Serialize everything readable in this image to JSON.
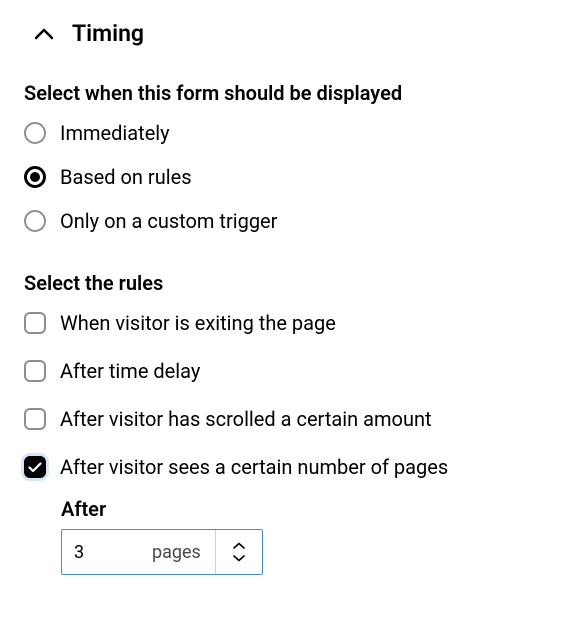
{
  "section": {
    "title": "Timing"
  },
  "display": {
    "title": "Select when this form should be displayed",
    "options": {
      "immediately": "Immediately",
      "based_on_rules": "Based on rules",
      "custom_trigger": "Only on a custom trigger"
    },
    "selected": "based_on_rules"
  },
  "rules": {
    "title": "Select the rules",
    "options": {
      "exiting": "When visitor is exiting the page",
      "time_delay": "After time delay",
      "scrolled": "After visitor has scrolled a certain amount",
      "page_count": "After visitor sees a certain number of pages"
    },
    "checked": [
      "page_count"
    ],
    "page_count_field": {
      "label": "After",
      "value": "3",
      "unit": "pages"
    }
  }
}
